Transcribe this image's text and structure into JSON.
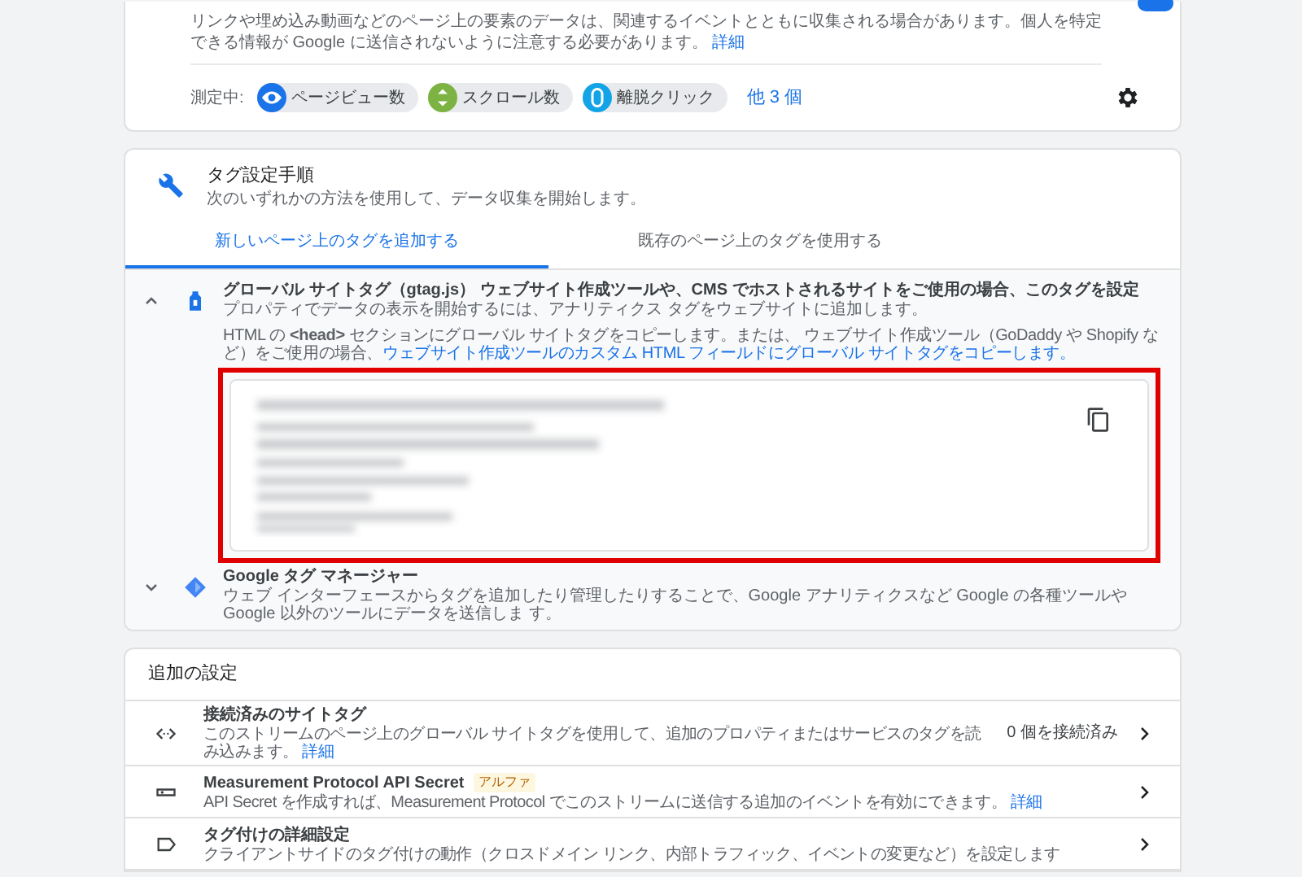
{
  "measurement_card": {
    "description": "リンクや埋め込み動画などのページ上の要素のデータは、関連するイベントとともに収集される場合があります。個人を特定できる情報が Google に送信されないように注意する必要があります。",
    "description_link": "詳細",
    "switch": {
      "on": true
    },
    "measuring_label": "測定中:",
    "chips": [
      {
        "label": "ページビュー数",
        "color": "#1a73e8",
        "kind": "eye"
      },
      {
        "label": "スクロール数",
        "color": "#7cb342",
        "kind": "scroll"
      },
      {
        "label": "離脱クリック",
        "color": "#12a4e6",
        "kind": "mouse"
      }
    ],
    "more_link": "他 3 個"
  },
  "tag_card": {
    "title": "タグ設定手順",
    "subtitle": "次のいずれかの方法を使用して、データ収集を開始します。",
    "tabs": [
      {
        "label": "新しいページ上のタグを追加する",
        "selected": true
      },
      {
        "label": "既存のページ上のタグを使用する",
        "selected": false
      }
    ],
    "options": [
      {
        "kind": "gtag",
        "expanded": true,
        "title": "グローバル サイトタグ（gtag.js） ウェブサイト作成ツールや、CMS でホストされるサイトをご使用の場合、このタグを設定",
        "subtitle": "プロパティでデータの表示を開始するには、アナリティクス タグをウェブサイトに追加します。",
        "instructions": "HTML の **<head>** セクションにグローバル サイトタグをコピーします。または、 ウェブサイト作成ツール（GoDaddy や Shopify など）をご使用の場合、",
        "instructions_link": "ウェブサイト作成ツールのカスタム HTML フィールドにグローバル サイトタグをコピーします。",
        "highlighted": true
      },
      {
        "kind": "gtm",
        "expanded": false,
        "title": "Google タグ マネージャー",
        "subtitle": "ウェブ インターフェースからタグを追加したり管理したりすることで、Google アナリティクスなど Google の各種ツールや Google 以外のツールにデータを送信しま す。"
      }
    ]
  },
  "additional_settings": {
    "title": "追加の設定",
    "rows": [
      {
        "kind": "code",
        "title": "接続済みのサイトタグ",
        "description": "このストリームのページ上のグローバル サイトタグを使用して、追加のプロパティまたはサービスのタグを読み込みます。",
        "link": "詳細",
        "value": "0 個を接続済み"
      },
      {
        "kind": "key",
        "title": "Measurement Protocol API Secret",
        "badge": "アルファ",
        "description": "API Secret を作成すれば、Measurement Protocol でこのストリームに送信する追加のイベントを有効にできます。",
        "link": "詳細"
      },
      {
        "kind": "label",
        "title": "タグ付けの詳細設定",
        "description": "クライアントサイドのタグ付けの動作（クロスドメイン リンク、内部トラフィック、イベントの変更など）を設定します"
      }
    ]
  }
}
